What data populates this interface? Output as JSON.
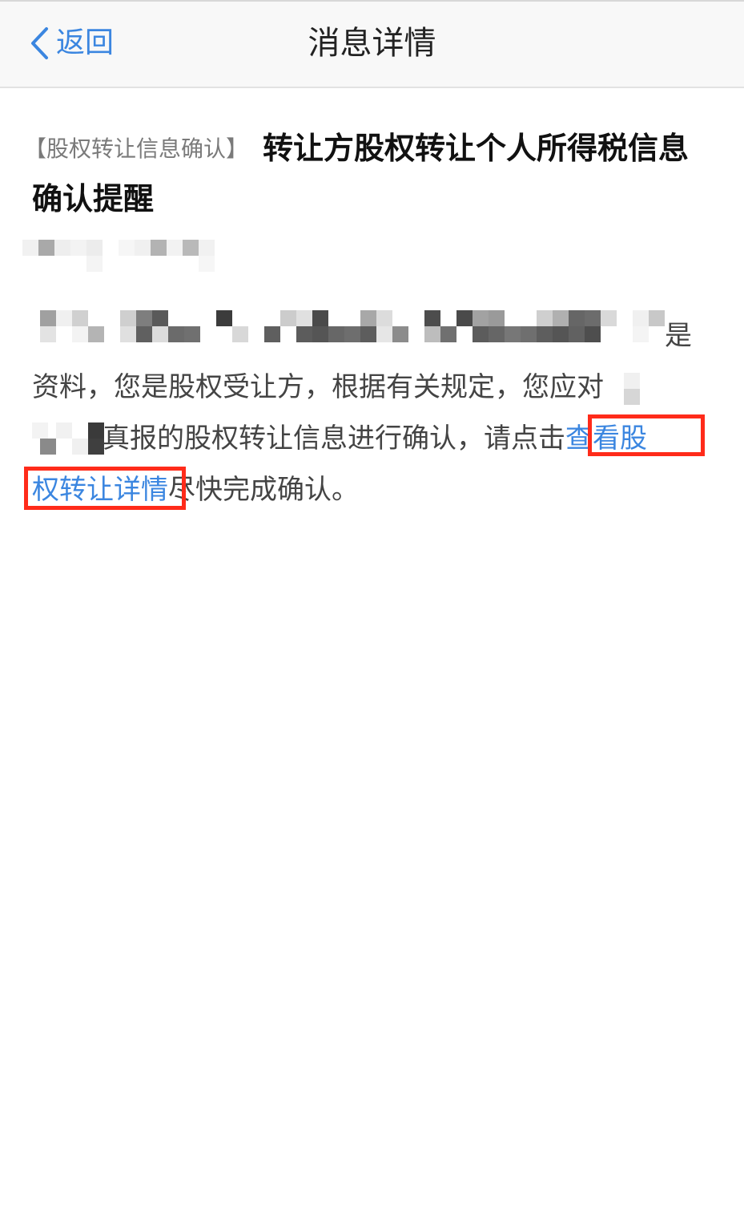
{
  "navbar": {
    "back_label": "返回",
    "title": "消息详情"
  },
  "message": {
    "tag": "【股权转让信息确认】",
    "title": "转让方股权转让个人所得税信息确认提醒",
    "body": {
      "line1_tail": "是",
      "line2": "资料，您是股权受让方，根据有关规定，您应对",
      "line3_text": "真报的股权转让信息进行确认，请点击",
      "link_text_part1": "查看股",
      "link_text_part2": "权转让详情",
      "line4_tail": "尽快完成确认。"
    }
  },
  "colors": {
    "accent": "#3b86e0",
    "highlight_box": "#ff2b1a"
  },
  "icons": {
    "back": "chevron-left-icon"
  }
}
